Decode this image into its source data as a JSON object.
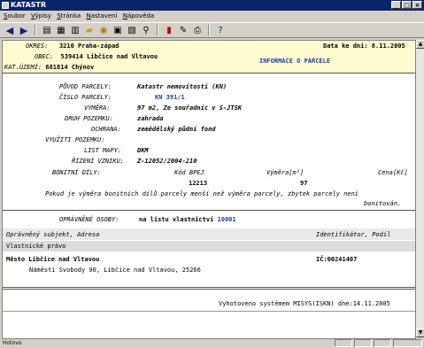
{
  "window": {
    "title": "KATASTR"
  },
  "menu": [
    "Soubor",
    "Výpisy",
    "Stránka",
    "Nastavení",
    "Nápověda"
  ],
  "header": {
    "okres_label": "OKRES:",
    "okres_value": "3210 Praha-západ",
    "date_label": "Data ke dni:",
    "date_value": "8.11.2005",
    "obec_label": "OBEC:",
    "obec_value": "539414 Libčice nad Vltavou",
    "doc_title": "INFORMACE O PARCELE",
    "ku_label": "KAT.ÚZEMÍ:",
    "ku_value": "681814 Chýnov"
  },
  "parcel": {
    "puvod_label": "PŮVOD PARCELY:",
    "puvod_value": "Katastr nemovitostí (KN)",
    "cislo_label": "ČÍSLO PARCELY:",
    "cislo_value": "KN 391/1",
    "vymera_label": "VÝMĚRA:",
    "vymera_value": "97 m2, Ze souřadnic v S-JTSK",
    "druh_label": "DRUH POZEMKU:",
    "druh_value": "zahrada",
    "ochrana_label": "OCHRANA:",
    "ochrana_value": "zemědělský půdní fond",
    "vyuziti_label": "VYUŽITÍ POZEMKU:",
    "list_label": "LIST MAPY:",
    "list_value": "DKM",
    "rizeni_label": "ŘÍZENÍ VZNIKU:",
    "rizeni_value": "Z-12052/2004-210"
  },
  "bonity": {
    "label": "BONITNÍ DÍLY:",
    "col_bpej": "Kód BPEJ",
    "col_vymera": "Výměra[m²]",
    "col_cena": "Cena[Kč]",
    "bpej": "12213",
    "vymera": "97",
    "note_line1": "Pokud je výměra bonitních dílů parcely menší než výměra parcely, zbytek parcely není",
    "note_line2": "bonitován."
  },
  "opravnene": {
    "label": "OPRÁVNĚNÉ OSOBY:",
    "value_prefix": "na listu vlastnictví",
    "lv": "10001",
    "col_subject": "Oprávněný subjekt, Adresa",
    "col_ident": "Identifikátor, Podíl",
    "section": "Vlastnické právo",
    "owner_name": "Město Libčice nad Vltavou",
    "owner_ic": "IČ:00241407",
    "owner_addr": "Náměstí Svobody 90, Libčice nad Vltavou, 25266"
  },
  "footer": {
    "generated": "Vyhotoveno systémem MISYS(ISKN) dne:14.11.2005"
  },
  "status": {
    "left": "Hotovo"
  }
}
